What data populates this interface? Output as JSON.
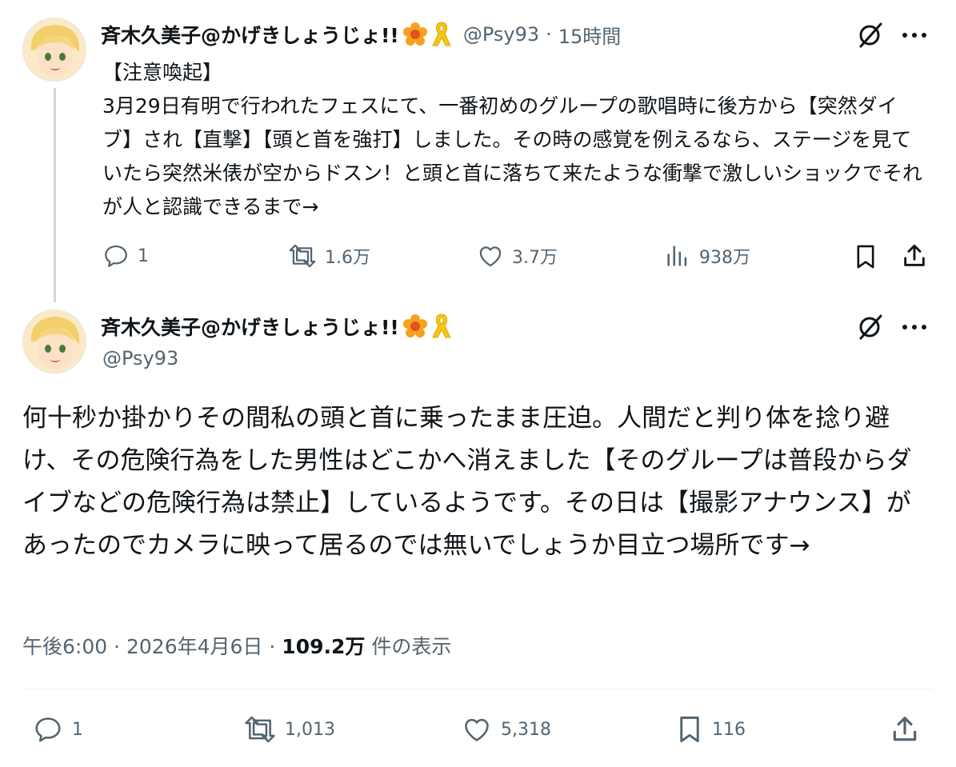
{
  "tweet1": {
    "display_name": "斉木久美子@かげきしょうじょ!!",
    "handle": "@Psy93",
    "separator": "·",
    "time_ago": "15時間",
    "heading": "【注意喚起】",
    "text": "3月29日有明で行われたフェスにて、一番初めのグループの歌唱時に後方から【突然ダイブ】され【直撃】【頭と首を強打】しました。その時の感覚を例えるなら、ステージを見ていたら突然米俵が空からドスン！と頭と首に落ちて来たような衝撃で激しいショックでそれが人と認識できるまで→",
    "replies": "1",
    "reposts": "1.6万",
    "likes": "3.7万",
    "views": "938万"
  },
  "tweet2": {
    "display_name": "斉木久美子@かげきしょうじょ!!",
    "handle": "@Psy93",
    "text": "何十秒か掛かりその間私の頭と首に乗ったまま圧迫。人間だと判り体を捻り避け、その危険行為をした男性はどこかへ消えました【そのグループは普段からダイブなどの危険行為は禁止】しているようです。その日は【撮影アナウンス】があったのでカメラに映って居るのでは無いでしょうか目立つ場所です→",
    "time": "午後6:00",
    "separator": "·",
    "date": "2026年4月6日",
    "separator2": "·",
    "views_count": "109.2万",
    "views_label": "件の表示",
    "replies": "1",
    "reposts": "1,013",
    "likes": "5,318",
    "bookmarks": "116"
  },
  "icons": [
    "grok-icon",
    "more-icon",
    "reply-icon",
    "repost-icon",
    "like-icon",
    "views-icon",
    "bookmark-icon",
    "share-icon",
    "flower-badge-icon",
    "ribbon-badge-icon"
  ],
  "colors": {
    "text": "#0f1419",
    "muted": "#536471",
    "line": "#cfd9de",
    "divider": "#eff3f4",
    "badge_orange": "#f6a21e",
    "ribbon_yellow": "#f5c518"
  }
}
